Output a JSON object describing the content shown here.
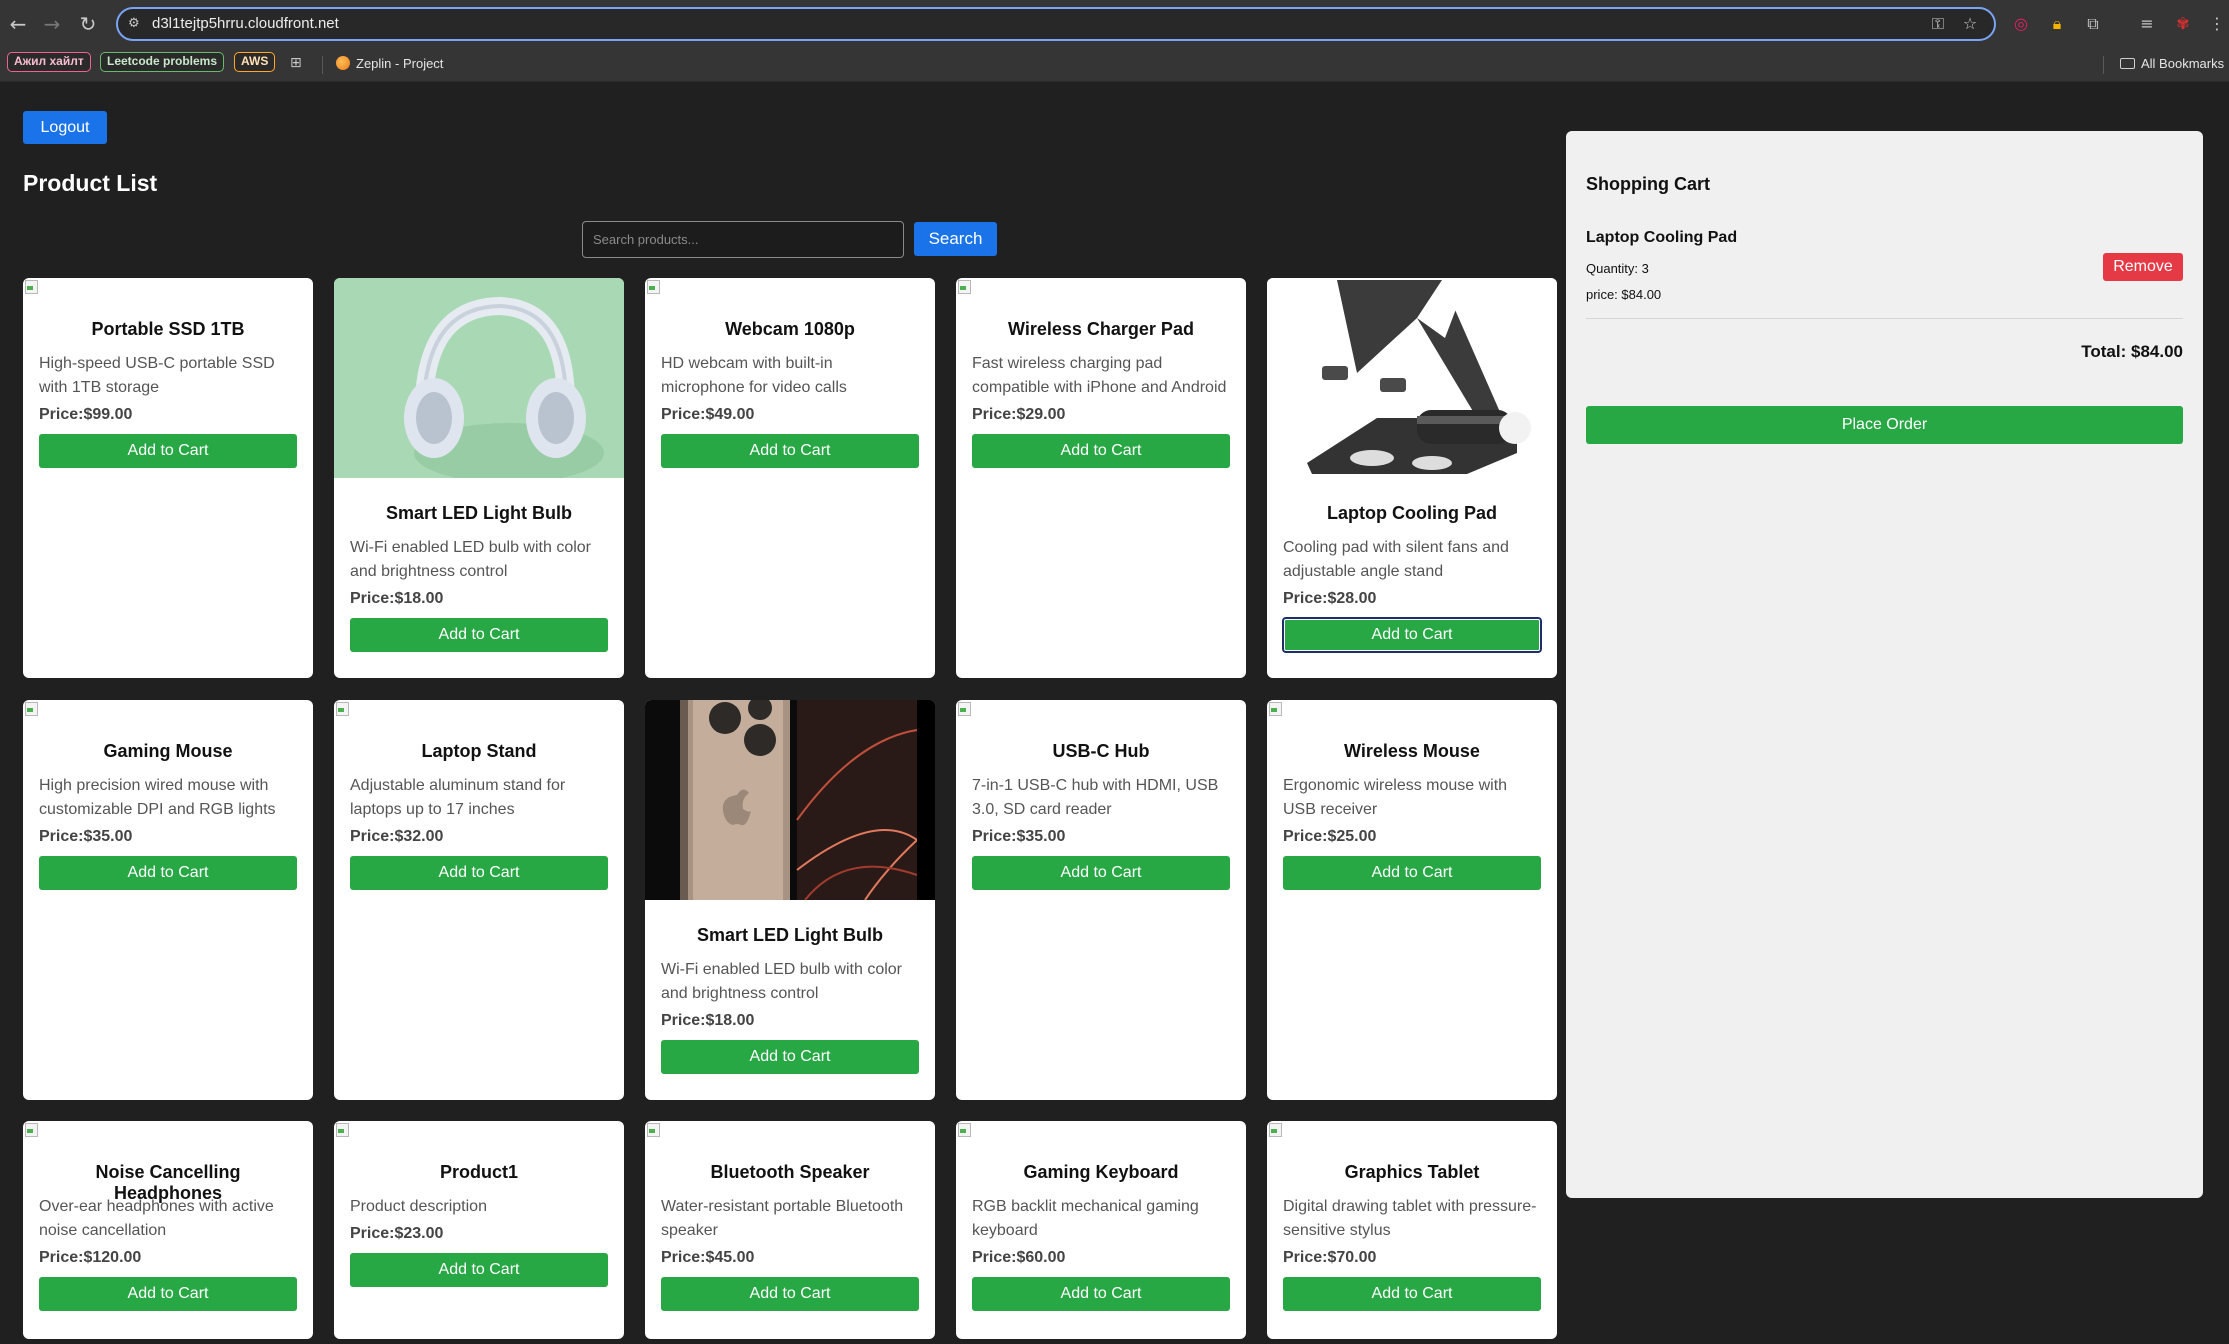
{
  "browser": {
    "url": "d3l1tejtp5hrru.cloudfront.net",
    "nav_icons": [
      "back-icon",
      "forward-icon",
      "reload-icon"
    ],
    "bookmarks": [
      {
        "label": "Ажил хайлт",
        "color": "#f06292"
      },
      {
        "label": "Leetcode problems",
        "color": "#66bb6a"
      },
      {
        "label": "AWS",
        "color": "#ffa726"
      }
    ],
    "zeplin_label": "Zeplin - Project",
    "all_bookmarks_label": "All Bookmarks"
  },
  "header": {
    "logout_label": "Logout",
    "title": "Product List"
  },
  "search": {
    "placeholder": "Search products...",
    "button_label": "Search"
  },
  "products": [
    {
      "name": "Portable SSD 1TB",
      "description": "High-speed USB-C portable SSD with 1TB storage",
      "price": "Price:$99.00",
      "button": "Add to Cart",
      "image": "broken"
    },
    {
      "name": "Smart LED Light Bulb",
      "description": "Wi-Fi enabled LED bulb with color and brightness control",
      "price": "Price:$18.00",
      "button": "Add to Cart",
      "image": "headphones"
    },
    {
      "name": "Webcam 1080p",
      "description": "HD webcam with built-in microphone for video calls",
      "price": "Price:$49.00",
      "button": "Add to Cart",
      "image": "broken"
    },
    {
      "name": "Wireless Charger Pad",
      "description": "Fast wireless charging pad compatible with iPhone and Android",
      "price": "Price:$29.00",
      "button": "Add to Cart",
      "image": "broken"
    },
    {
      "name": "Laptop Cooling Pad",
      "description": "Cooling pad with silent fans and adjustable angle stand",
      "price": "Price:$28.00",
      "button": "Add to Cart",
      "image": "stand",
      "focused": true
    },
    {
      "name": "Gaming Mouse",
      "description": "High precision wired mouse with customizable DPI and RGB lights",
      "price": "Price:$35.00",
      "button": "Add to Cart",
      "image": "broken"
    },
    {
      "name": "Laptop Stand",
      "description": "Adjustable aluminum stand for laptops up to 17 inches",
      "price": "Price:$32.00",
      "button": "Add to Cart",
      "image": "broken"
    },
    {
      "name": "Smart LED Light Bulb",
      "description": "Wi-Fi enabled LED bulb with color and brightness control",
      "price": "Price:$18.00",
      "button": "Add to Cart",
      "image": "phone"
    },
    {
      "name": "USB-C Hub",
      "description": "7-in-1 USB-C hub with HDMI, USB 3.0, SD card reader",
      "price": "Price:$35.00",
      "button": "Add to Cart",
      "image": "broken"
    },
    {
      "name": "Wireless Mouse",
      "description": "Ergonomic wireless mouse with USB receiver",
      "price": "Price:$25.00",
      "button": "Add to Cart",
      "image": "broken"
    },
    {
      "name": "Noise Cancelling Headphones",
      "description": "Over-ear headphones with active noise cancellation",
      "price": "Price:$120.00",
      "button": "Add to Cart",
      "image": "broken"
    },
    {
      "name": "Product1",
      "description": "Product description",
      "price": "Price:$23.00",
      "button": "Add to Cart",
      "image": "broken"
    },
    {
      "name": "Bluetooth Speaker",
      "description": "Water-resistant portable Bluetooth speaker",
      "price": "Price:$45.00",
      "button": "Add to Cart",
      "image": "broken"
    },
    {
      "name": "Gaming Keyboard",
      "description": "RGB backlit mechanical gaming keyboard",
      "price": "Price:$60.00",
      "button": "Add to Cart",
      "image": "broken"
    },
    {
      "name": "Graphics Tablet",
      "description": "Digital drawing tablet with pressure-sensitive stylus",
      "price": "Price:$70.00",
      "button": "Add to Cart",
      "image": "broken"
    }
  ],
  "cart": {
    "title": "Shopping Cart",
    "items": [
      {
        "name": "Laptop Cooling Pad",
        "quantity": "Quantity: 3",
        "price": "price: $84.00",
        "remove_label": "Remove"
      }
    ],
    "total": "Total: $84.00",
    "place_order_label": "Place Order"
  },
  "colors": {
    "primary_blue": "#1a73e8",
    "add_green": "#28a745",
    "remove_red": "#e63946",
    "page_bg": "#202020",
    "cart_bg": "#f0f0f0"
  }
}
